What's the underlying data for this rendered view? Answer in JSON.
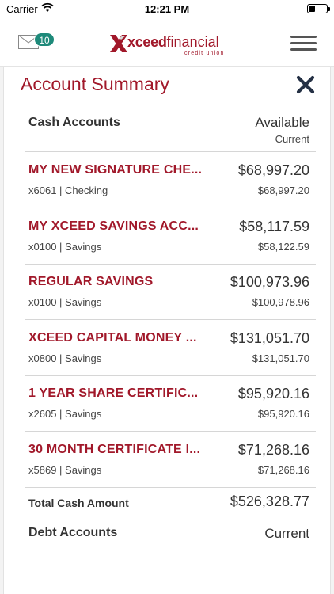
{
  "status_bar": {
    "carrier": "Carrier",
    "time": "12:21 PM"
  },
  "header": {
    "message_count": "10",
    "logo_bold": "xceed",
    "logo_light": "financial",
    "logo_sub": "credit union",
    "brand_color": "#a1182a"
  },
  "summary": {
    "title": "Account Summary",
    "cash_header": {
      "label": "Cash Accounts",
      "right": "Available",
      "sub": "Current"
    },
    "accounts": [
      {
        "name": "MY NEW SIGNATURE CHE...",
        "detail": "x6061 | Checking",
        "balance": "$68,997.20",
        "available": "$68,997.20"
      },
      {
        "name": "MY XCEED SAVINGS ACC...",
        "detail": "x0100 | Savings",
        "balance": "$58,117.59",
        "available": "$58,122.59"
      },
      {
        "name": "REGULAR SAVINGS",
        "detail": "x0100 | Savings",
        "balance": "$100,973.96",
        "available": "$100,978.96"
      },
      {
        "name": "XCEED CAPITAL MONEY ...",
        "detail": "x0800 | Savings",
        "balance": "$131,051.70",
        "available": "$131,051.70"
      },
      {
        "name": "1 YEAR SHARE CERTIFIC...",
        "detail": "x2605 | Savings",
        "balance": "$95,920.16",
        "available": "$95,920.16"
      },
      {
        "name": "30 MONTH CERTIFICATE I...",
        "detail": "x5869 | Savings",
        "balance": "$71,268.16",
        "available": "$71,268.16"
      }
    ],
    "total": {
      "label": "Total Cash Amount",
      "value": "$526,328.77"
    },
    "debt_header": {
      "label": "Debt Accounts",
      "right": "Current"
    }
  }
}
